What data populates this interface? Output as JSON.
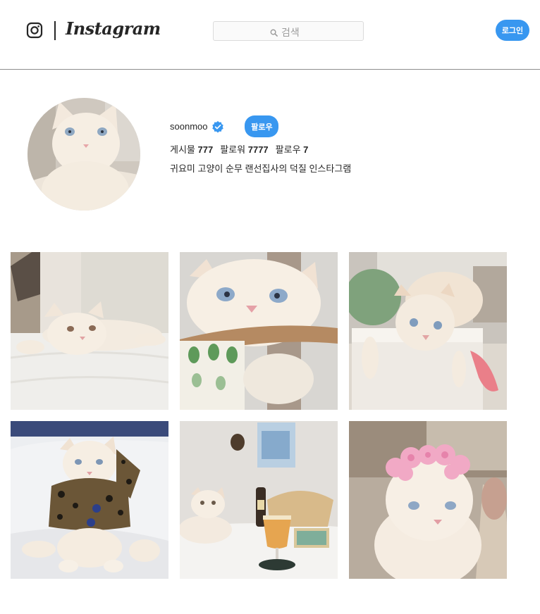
{
  "header": {
    "logo_text": "Instagram",
    "search_placeholder": "검색",
    "login_label": "로그인"
  },
  "profile": {
    "username": "soonmoo",
    "verified": true,
    "follow_label": "팔로우",
    "stats": [
      {
        "label": "게시물",
        "value": "777"
      },
      {
        "label": "팔로워",
        "value": "7777"
      },
      {
        "label": "팔로우",
        "value": "7"
      }
    ],
    "bio": "귀요미 고양이 순무 랜선집사의 덕질 인스타그램"
  },
  "posts": [
    {
      "subject": "cat lying on white bed"
    },
    {
      "subject": "cat face resting on hammock bed"
    },
    {
      "subject": "cat leaning over white box"
    },
    {
      "subject": "cat wearing leopard print outfit"
    },
    {
      "subject": "cat sitting beside beer glass and bottle"
    },
    {
      "subject": "cat wearing pink flower crown"
    }
  ],
  "colors": {
    "accent": "#3897f0",
    "divider": "#8e8e8e",
    "cat_fur": "#f6eee3"
  }
}
